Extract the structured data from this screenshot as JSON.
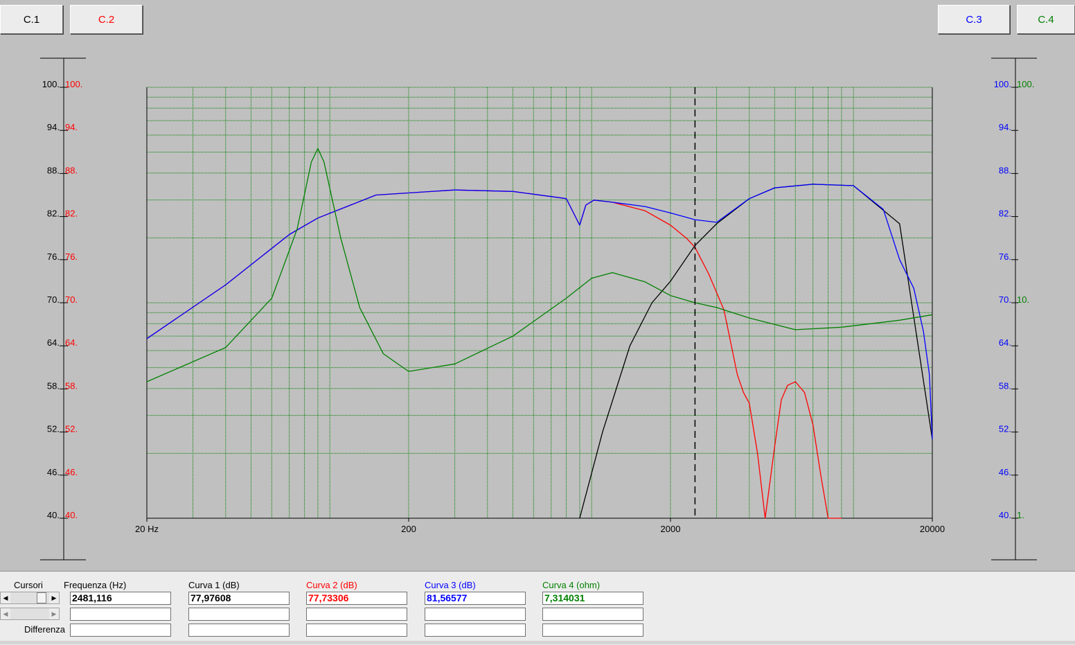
{
  "buttons": {
    "c1": {
      "label": "C.1",
      "color": "#000000"
    },
    "c2": {
      "label": "C.2",
      "color": "#ff0000"
    },
    "c3": {
      "label": "C.3",
      "color": "#0000ff"
    },
    "c4": {
      "label": "C.4",
      "color": "#008000"
    }
  },
  "chart_data": {
    "type": "line",
    "xscale": "log",
    "xlim": [
      20,
      20000
    ],
    "x_tick_labels": [
      "20 Hz",
      "200",
      "2000",
      "20000"
    ],
    "x_ticks": [
      20,
      200,
      2000,
      20000
    ],
    "ylim": [
      40,
      100
    ],
    "grid": true,
    "axes": {
      "left_black": {
        "ticks": [
          100,
          94,
          88,
          82,
          76,
          70,
          64,
          58,
          52,
          46,
          40
        ],
        "labels": [
          "100.",
          "94.",
          "88.",
          "82.",
          "76.",
          "70.",
          "64.",
          "58.",
          "52.",
          "46.",
          "40."
        ],
        "color": "#000000"
      },
      "left_red": {
        "labels": [
          "100.",
          "94.",
          "88.",
          "82.",
          "76.",
          "70.",
          "64.",
          "58.",
          "52.",
          "46.",
          "40."
        ],
        "color": "#ff0000"
      },
      "right_blue": {
        "labels": [
          "100.",
          "94.",
          "88.",
          "82.",
          "76.",
          "70.",
          "64.",
          "58.",
          "52.",
          "46.",
          "40."
        ],
        "color": "#0000ff"
      },
      "right_green": {
        "labels": [
          "100.",
          "10.",
          "1."
        ],
        "values": [
          100,
          10,
          1
        ],
        "scale": "log",
        "color": "#008000"
      }
    },
    "cursor_frequency": 2481.116,
    "series": [
      {
        "color": "#000000",
        "axis": "left",
        "x": [
          900,
          1100,
          1400,
          1700,
          2000,
          2481,
          3000,
          4000,
          5000,
          7000,
          10000,
          15000,
          20000
        ],
        "y": [
          40,
          52,
          64,
          70,
          73,
          77.98,
          81,
          84.5,
          86,
          86.5,
          86.3,
          81,
          51
        ]
      },
      {
        "color": "#ff0000",
        "axis": "left",
        "x": [
          20,
          40,
          70,
          90,
          150,
          300,
          500,
          800,
          900,
          950,
          1020,
          1200,
          1600,
          2000,
          2300,
          2481,
          2800,
          3200,
          3600,
          3800,
          4000,
          4300,
          4600,
          5000,
          5300,
          5600,
          6000,
          6500,
          7000,
          7500,
          8000,
          9000
        ],
        "y": [
          65,
          72.5,
          79.5,
          81.8,
          85,
          85.7,
          85.5,
          84.5,
          80.8,
          83.6,
          84.3,
          84.0,
          82.8,
          80.8,
          79.0,
          77.73,
          74,
          69,
          60,
          57.5,
          56,
          49,
          40,
          50,
          56.5,
          58.5,
          59,
          57.5,
          53,
          46,
          40,
          40
        ]
      },
      {
        "color": "#0000ff",
        "axis": "left",
        "x": [
          20,
          40,
          70,
          90,
          150,
          300,
          500,
          800,
          900,
          950,
          1020,
          1200,
          1600,
          2000,
          2481,
          3000,
          4000,
          5000,
          7000,
          10000,
          13000,
          15000,
          17000,
          18500,
          19500,
          20000
        ],
        "y": [
          65,
          72.5,
          79.5,
          81.8,
          85,
          85.7,
          85.5,
          84.5,
          80.8,
          83.6,
          84.3,
          84.0,
          83.4,
          82.5,
          81.57,
          81.2,
          84.5,
          86,
          86.5,
          86.3,
          83,
          76,
          72,
          66,
          60,
          51
        ]
      },
      {
        "color": "#008000",
        "axis": "right_log",
        "x": [
          20,
          40,
          60,
          75,
          85,
          90,
          95,
          110,
          130,
          160,
          200,
          300,
          500,
          800,
          1000,
          1200,
          1600,
          2000,
          2481,
          3000,
          4000,
          6000,
          9000,
          15000,
          20000
        ],
        "y": [
          4.3,
          6.2,
          10.5,
          22,
          45,
          52,
          45,
          20,
          9.5,
          5.8,
          4.8,
          5.2,
          7.0,
          10.5,
          13,
          13.8,
          12.5,
          10.8,
          10.0,
          9.5,
          8.5,
          7.5,
          7.7,
          8.3,
          8.8
        ]
      }
    ]
  },
  "panel": {
    "cursori_label": "Cursori",
    "differenza_label": "Differenza",
    "columns": [
      {
        "header": "Frequenza (Hz)",
        "color": "#000000",
        "value": "2481,116"
      },
      {
        "header": "Curva 1 (dB)",
        "color": "#000000",
        "value": "77,97608"
      },
      {
        "header": "Curva 2 (dB)",
        "color": "#ff0000",
        "value": "77,73306"
      },
      {
        "header": "Curva 3 (dB)",
        "color": "#0000ff",
        "value": "81,56577"
      },
      {
        "header": "Curva 4 (ohm)",
        "color": "#008000",
        "value": "7,314031"
      }
    ]
  }
}
